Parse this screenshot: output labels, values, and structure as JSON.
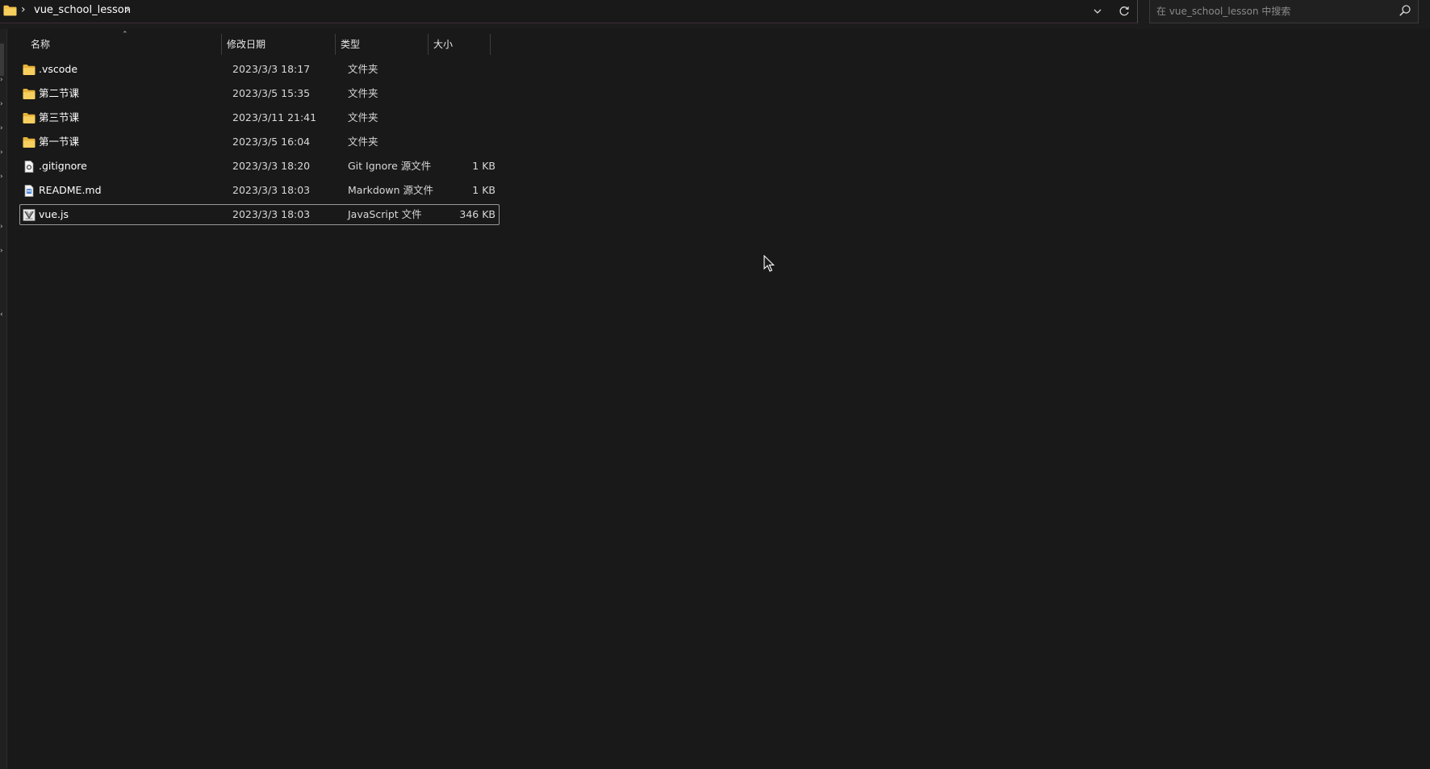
{
  "address_bar": {
    "crumbs": [
      "vue_school_lesson"
    ],
    "icons": {
      "location": "folder-icon",
      "separator": "chevron-right-icon",
      "history": "chevron-down-icon",
      "refresh": "refresh-icon"
    }
  },
  "search": {
    "placeholder": "在 vue_school_lesson 中搜索",
    "icon": "search-icon"
  },
  "columns": {
    "name": "名称",
    "date": "修改日期",
    "type": "类型",
    "size": "大小",
    "sorted_by": "name"
  },
  "files": [
    {
      "icon": "folder-icon",
      "name": ".vscode",
      "date": "2023/3/3 18:17",
      "type": "文件夹",
      "size": ""
    },
    {
      "icon": "folder-icon",
      "name": "第二节课",
      "date": "2023/3/5 15:35",
      "type": "文件夹",
      "size": ""
    },
    {
      "icon": "folder-icon",
      "name": "第三节课",
      "date": "2023/3/11 21:41",
      "type": "文件夹",
      "size": ""
    },
    {
      "icon": "folder-icon",
      "name": "第一节课",
      "date": "2023/3/5 16:04",
      "type": "文件夹",
      "size": ""
    },
    {
      "icon": "gitignore-file-icon",
      "name": ".gitignore",
      "date": "2023/3/3 18:20",
      "type": "Git Ignore 源文件",
      "size": "1 KB"
    },
    {
      "icon": "markdown-file-icon",
      "name": "README.md",
      "date": "2023/3/3 18:03",
      "type": "Markdown 源文件",
      "size": "1 KB"
    },
    {
      "icon": "javascript-file-icon",
      "name": "vue.js",
      "date": "2023/3/3 18:03",
      "type": "JavaScript 文件",
      "size": "346 KB",
      "selected": true
    }
  ],
  "colors": {
    "background": "#191919",
    "folder": "#f2c14b",
    "selection_border": "#9a9a9a"
  }
}
